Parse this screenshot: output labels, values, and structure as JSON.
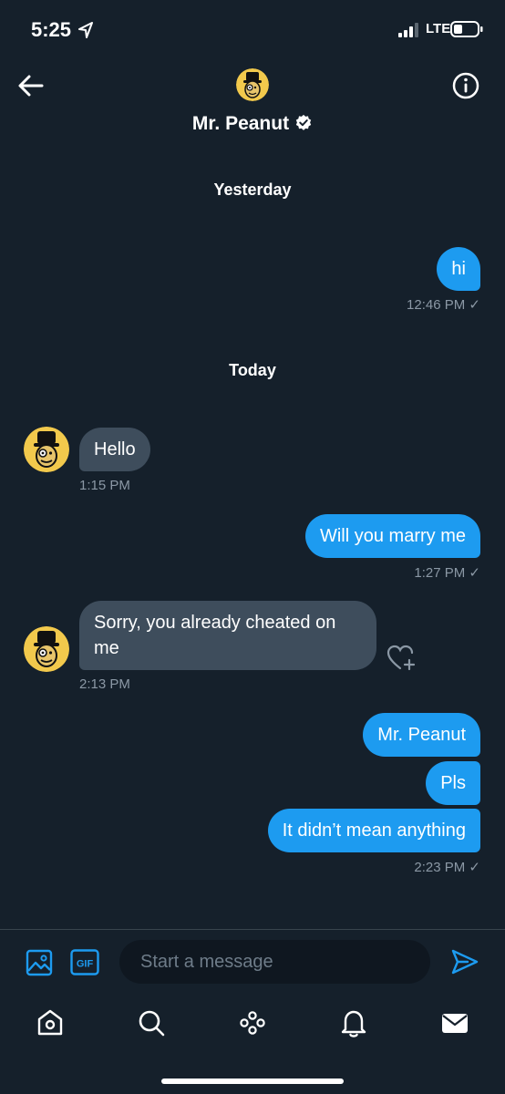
{
  "status_bar": {
    "time": "5:25",
    "network": "LTE"
  },
  "header": {
    "name": "Mr. Peanut"
  },
  "conversation": {
    "days": [
      "Yesterday",
      "Today"
    ],
    "messages": [
      {
        "direction": "out",
        "text": "hi"
      },
      {
        "direction": "in",
        "text": "Hello"
      },
      {
        "direction": "out",
        "text": "Will you marry me"
      },
      {
        "direction": "in",
        "text": "Sorry, you already cheated on me"
      },
      {
        "direction": "out",
        "text": "Mr. Peanut"
      },
      {
        "direction": "out",
        "text": "Pls"
      },
      {
        "direction": "out",
        "text": "It didn’t mean anything"
      }
    ],
    "timestamps": [
      "12:46 PM",
      "1:15 PM",
      "1:27 PM",
      "2:13 PM",
      "2:23 PM"
    ],
    "read_mark": "✓"
  },
  "composer": {
    "placeholder": "Start a message",
    "gif_label": "GIF"
  },
  "icons": {
    "back": "back-arrow-icon",
    "info": "info-icon",
    "verified": "verified-badge-icon",
    "like": "heart-plus-icon",
    "image": "image-icon",
    "gif": "gif-icon",
    "send": "send-icon",
    "tabs": [
      "home-icon",
      "search-icon",
      "spaces-icon",
      "bell-icon",
      "mail-icon"
    ]
  },
  "colors": {
    "background": "#15202b",
    "accent": "#1d9bf0",
    "incoming_bubble": "#3e4d5c",
    "muted": "#8b98a5"
  }
}
